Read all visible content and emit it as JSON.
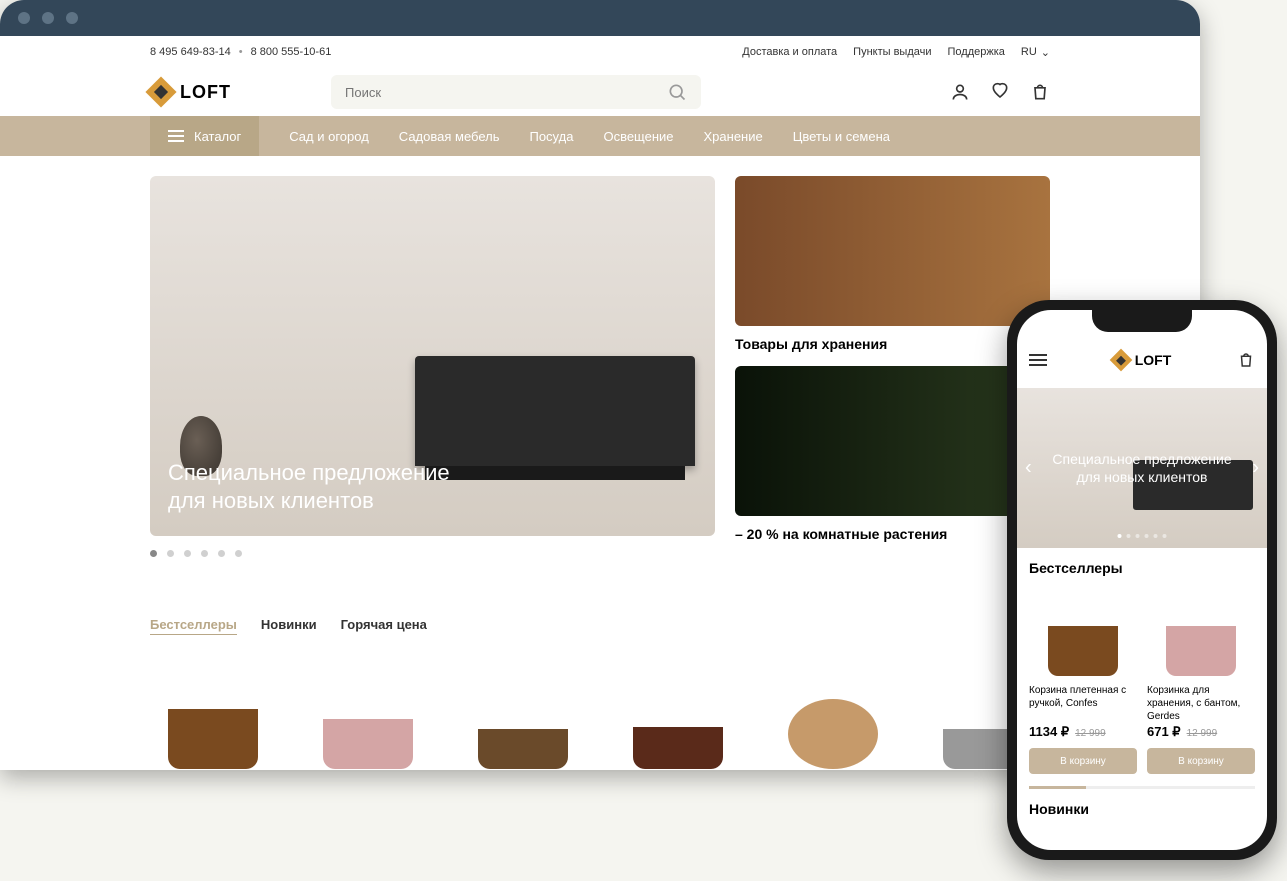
{
  "topbar": {
    "phone1": "8 495 649-83-14",
    "phone2": "8 800 555-10-61",
    "links": [
      "Доставка и оплата",
      "Пункты выдачи",
      "Поддержка"
    ],
    "lang": "RU"
  },
  "header": {
    "brand": "LOFT",
    "search_placeholder": "Поиск"
  },
  "nav": {
    "catalog": "Каталог",
    "items": [
      "Сад и огород",
      "Садовая мебель",
      "Посуда",
      "Освещение",
      "Хранение",
      "Цветы и семена"
    ]
  },
  "hero": {
    "title_line1": "Специальное предложение",
    "title_line2": "для новых клиентов"
  },
  "side_cards": [
    {
      "title": "Товары для хранения"
    },
    {
      "title": "– 20 % на комнатные растения"
    }
  ],
  "tabs": [
    "Бестселлеры",
    "Новинки",
    "Горячая цена"
  ],
  "mobile": {
    "hero_line1": "Специальное предложение",
    "hero_line2": "для новых клиентов",
    "section_title": "Бестселлеры",
    "novinki": "Новинки",
    "products": [
      {
        "name": "Корзина плетенная с ручкой, Confes",
        "price": "1134 ₽",
        "old": "12 999",
        "btn": "В корзину"
      },
      {
        "name": "Корзинка для хранения, с бантом, Gerdes",
        "price": "671 ₽",
        "old": "12 999",
        "btn": "В корзину"
      }
    ]
  }
}
